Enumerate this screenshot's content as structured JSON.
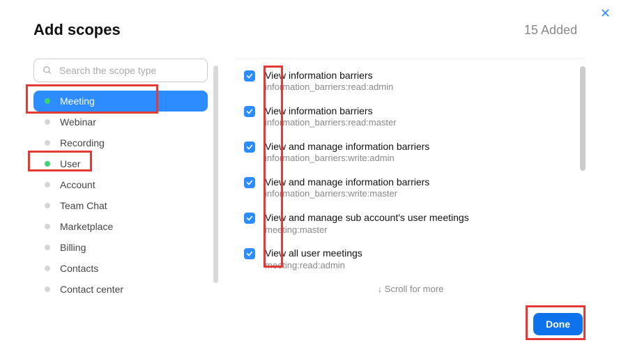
{
  "header": {
    "title": "Add scopes",
    "added_text": "15 Added"
  },
  "search": {
    "placeholder": "Search the scope type"
  },
  "sidebar": {
    "items": [
      {
        "label": "Meeting",
        "dot": "green",
        "active": true
      },
      {
        "label": "Webinar",
        "dot": "gray",
        "active": false
      },
      {
        "label": "Recording",
        "dot": "gray",
        "active": false
      },
      {
        "label": "User",
        "dot": "green",
        "active": false
      },
      {
        "label": "Account",
        "dot": "gray",
        "active": false
      },
      {
        "label": "Team Chat",
        "dot": "gray",
        "active": false
      },
      {
        "label": "Marketplace",
        "dot": "gray",
        "active": false
      },
      {
        "label": "Billing",
        "dot": "gray",
        "active": false
      },
      {
        "label": "Contacts",
        "dot": "gray",
        "active": false
      },
      {
        "label": "Contact center",
        "dot": "gray",
        "active": false
      }
    ]
  },
  "permissions": [
    {
      "title": "View information barriers",
      "code": "information_barriers:read:admin",
      "checked": true
    },
    {
      "title": "View information barriers",
      "code": "information_barriers:read:master",
      "checked": true
    },
    {
      "title": "View and manage information barriers",
      "code": "information_barriers:write:admin",
      "checked": true
    },
    {
      "title": "View and manage information barriers",
      "code": "information_barriers:write:master",
      "checked": true
    },
    {
      "title": "View and manage sub account's user meetings",
      "code": "meeting:master",
      "checked": true
    },
    {
      "title": "View all user meetings",
      "code": "meeting:read:admin",
      "checked": true
    }
  ],
  "scroll_more_text": "↓ Scroll for more",
  "footer": {
    "done_label": "Done"
  }
}
